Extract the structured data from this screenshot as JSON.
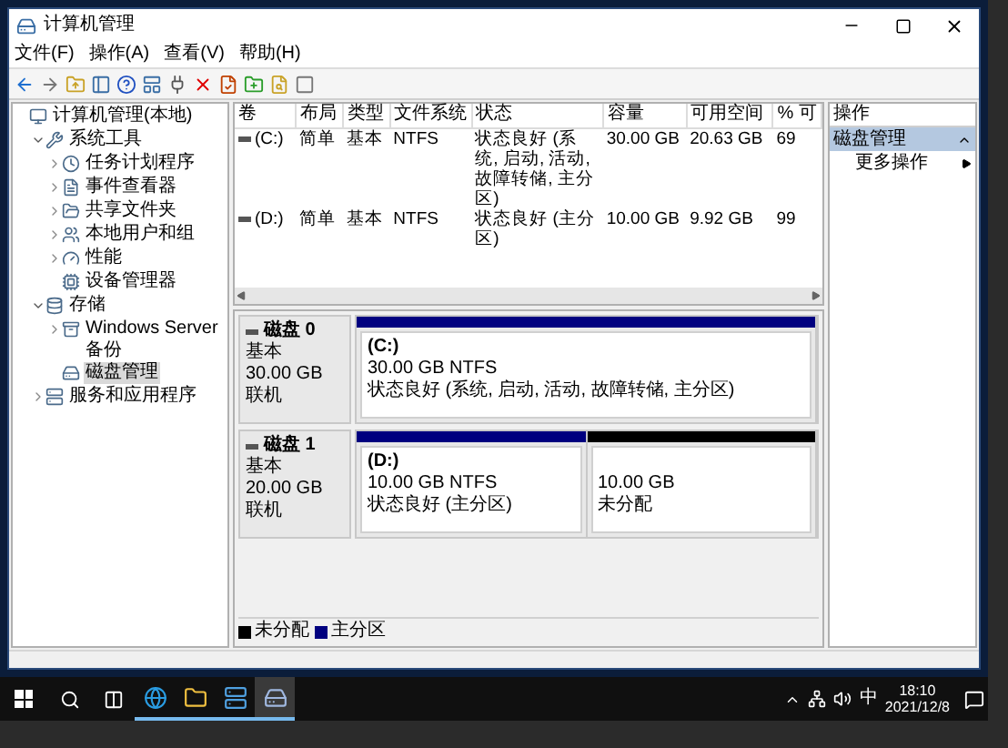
{
  "window": {
    "title": "计算机管理",
    "menu": [
      "文件(F)",
      "操作(A)",
      "查看(V)",
      "帮助(H)"
    ]
  },
  "tree": [
    {
      "label": "计算机管理(本地)",
      "kind": "computer",
      "selected": false,
      "children": [
        {
          "label": "系统工具",
          "kind": "tools",
          "selected": false,
          "expanded": true,
          "children": [
            {
              "label": "任务计划程序",
              "kind": "clock",
              "selected": false,
              "expanded": false
            },
            {
              "label": "事件查看器",
              "kind": "log",
              "selected": false,
              "expanded": false
            },
            {
              "label": "共享文件夹",
              "kind": "share",
              "selected": false,
              "expanded": false
            },
            {
              "label": "本地用户和组",
              "kind": "users",
              "selected": false,
              "expanded": false
            },
            {
              "label": "性能",
              "kind": "performance",
              "selected": false,
              "expanded": false
            },
            {
              "label": "设备管理器",
              "kind": "device",
              "selected": false
            }
          ]
        },
        {
          "label": "存储",
          "kind": "storage",
          "selected": false,
          "expanded": true,
          "children": [
            {
              "label": "Windows Server 备份",
              "kind": "backup",
              "selected": false,
              "expanded": false
            },
            {
              "label": "磁盘管理",
              "kind": "disk",
              "selected": true
            }
          ]
        },
        {
          "label": "服务和应用程序",
          "kind": "services",
          "selected": false,
          "expanded": false
        }
      ]
    }
  ],
  "table": {
    "columns": [
      "卷",
      "布局",
      "类型",
      "文件系统",
      "状态",
      "容量",
      "可用空间",
      "% 可"
    ],
    "rows": [
      [
        "(C:)",
        "简单",
        "基本",
        "NTFS",
        "状态良好 (系统, 启动, 活动, 故障转储, 主分区)",
        "30.00 GB",
        "20.63 GB",
        "69"
      ],
      [
        "(D:)",
        "简单",
        "基本",
        "NTFS",
        "状态良好 (主分区)",
        "10.00 GB",
        "9.92 GB",
        "99"
      ]
    ]
  },
  "disks": [
    {
      "name": "磁盘 0",
      "type": "基本",
      "size": "30.00 GB",
      "status": "联机",
      "partitions": [
        {
          "kind": "primary",
          "label": "(C:)",
          "size": "30.00 GB NTFS",
          "status": "状态良好 (系统, 启动, 活动, 故障转储, 主分区)"
        }
      ]
    },
    {
      "name": "磁盘 1",
      "type": "基本",
      "size": "20.00 GB",
      "status": "联机",
      "partitions": [
        {
          "kind": "primary",
          "label": "(D:)",
          "size": "10.00 GB NTFS",
          "status": "状态良好 (主分区)"
        },
        {
          "kind": "unallocated",
          "size": "10.00 GB",
          "status": "未分配"
        }
      ]
    }
  ],
  "legend": [
    {
      "kind": "unallocated",
      "label": "未分配"
    },
    {
      "kind": "primary",
      "label": "主分区"
    }
  ],
  "actions": {
    "header": "操作",
    "section": "磁盘管理",
    "items": [
      "更多操作"
    ]
  },
  "taskbar": {
    "apps": [
      {
        "kind": "browser",
        "active": false
      },
      {
        "kind": "folder",
        "active": false
      },
      {
        "kind": "server",
        "active": false
      },
      {
        "kind": "management",
        "active": true
      }
    ],
    "ime": "中",
    "time": "18:10",
    "date": "2021/12/8"
  }
}
